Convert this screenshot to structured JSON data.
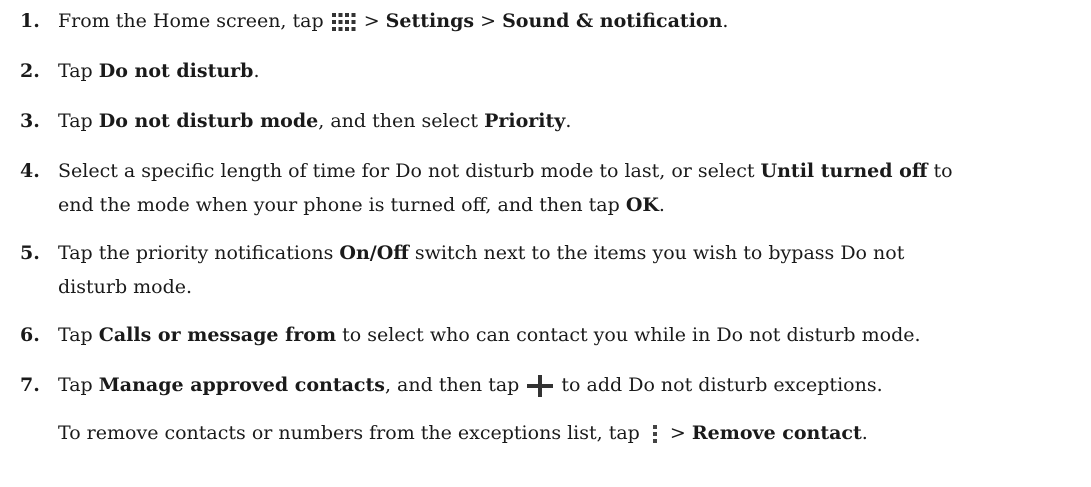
{
  "steps": [
    {
      "number": "1.",
      "parts": {
        "a": "From the Home screen, tap ",
        "b": " > ",
        "c": "Settings",
        "d": " > ",
        "e": "Sound & notification",
        "f": "."
      }
    },
    {
      "number": "2.",
      "parts": {
        "a": "Tap ",
        "b": "Do not disturb",
        "c": "."
      }
    },
    {
      "number": "3.",
      "parts": {
        "a": "Tap ",
        "b": "Do not disturb mode",
        "c": ", and then select ",
        "d": "Priority",
        "e": "."
      }
    },
    {
      "number": "4.",
      "parts": {
        "a": "Select a specific length of time for Do not disturb mode to last, or select ",
        "b": "Until turned off",
        "c": " to",
        "d": "end the mode when your phone is turned off, and then tap ",
        "e": "OK",
        "f": "."
      }
    },
    {
      "number": "5.",
      "parts": {
        "a": "Tap the priority notifications ",
        "b": "On/Off",
        "c": " switch next to the items you wish to bypass Do not",
        "d": "disturb mode."
      }
    },
    {
      "number": "6.",
      "parts": {
        "a": "Tap ",
        "b": "Calls or message from",
        "c": " to select who can contact you while in Do not disturb mode."
      }
    },
    {
      "number": "7.",
      "parts": {
        "a": "Tap ",
        "b": "Manage approved contacts",
        "c": ", and then tap ",
        "d": " to add Do not disturb exceptions."
      }
    }
  ],
  "note": {
    "a": "To remove contacts or numbers from the exceptions list, tap ",
    "b": " > ",
    "c": "Remove contact",
    "d": "."
  },
  "icons": {
    "apps": "all-apps-grid-icon",
    "add": "plus-icon",
    "menu": "overflow-menu-icon"
  },
  "colors": {
    "text": "#1a1a1a",
    "icon": "#333333"
  }
}
